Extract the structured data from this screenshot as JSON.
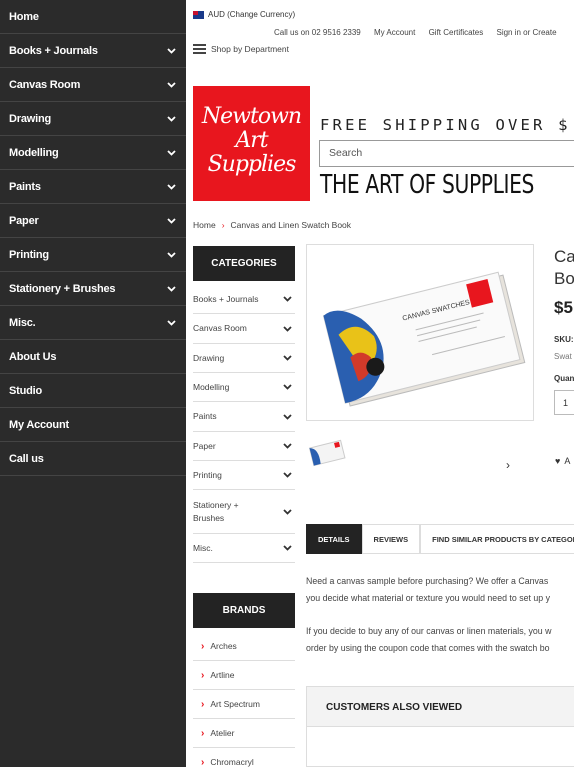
{
  "drawer": {
    "items": [
      {
        "label": "Home",
        "has_chevron": false
      },
      {
        "label": "Books + Journals",
        "has_chevron": true
      },
      {
        "label": "Canvas Room",
        "has_chevron": true
      },
      {
        "label": "Drawing",
        "has_chevron": true
      },
      {
        "label": "Modelling",
        "has_chevron": true
      },
      {
        "label": "Paints",
        "has_chevron": true
      },
      {
        "label": "Paper",
        "has_chevron": true
      },
      {
        "label": "Printing",
        "has_chevron": true
      },
      {
        "label": "Stationery + Brushes",
        "has_chevron": true
      },
      {
        "label": "Misc.",
        "has_chevron": true
      },
      {
        "label": "About Us",
        "has_chevron": false
      },
      {
        "label": "Studio",
        "has_chevron": false
      },
      {
        "label": "My Account",
        "has_chevron": false
      },
      {
        "label": "Call us",
        "has_chevron": false
      }
    ]
  },
  "header": {
    "currency": "AUD (Change Currency)",
    "phone": "Call us on 02 9516 2339",
    "my_account": "My Account",
    "gift_certificates": "Gift Certificates",
    "sign_in": "Sign in or Create",
    "shop_by_department": "Shop by Department",
    "logo": {
      "line1": "Newtown",
      "line2": "Art",
      "line3": "Supplies"
    },
    "free_shipping": "FREE SHIPPING OVER $",
    "search_placeholder": "Search",
    "tagline": "THE ART OF SUPPLIES"
  },
  "breadcrumb": {
    "home": "Home",
    "separator": "›",
    "current": "Canvas and Linen Swatch Book"
  },
  "categories": {
    "title": "CATEGORIES",
    "items": [
      {
        "label": "Books + Journals"
      },
      {
        "label": "Canvas Room"
      },
      {
        "label": "Drawing"
      },
      {
        "label": "Modelling"
      },
      {
        "label": "Paints"
      },
      {
        "label": "Paper"
      },
      {
        "label": "Printing"
      },
      {
        "label": "Stationery +\nBrushes"
      },
      {
        "label": "Misc."
      }
    ]
  },
  "brands": {
    "title": "BRANDS",
    "items": [
      {
        "label": "Arches"
      },
      {
        "label": "Artline"
      },
      {
        "label": "Art Spectrum"
      },
      {
        "label": "Atelier"
      },
      {
        "label": "Chromacryl"
      }
    ]
  },
  "product": {
    "title_line1": "Ca",
    "title_line2": "Bo",
    "price": "$5",
    "sku_label": "SKU:",
    "sku_value": "Swat",
    "quantity_label": "Quan",
    "quantity_value": "1",
    "wishlist_label": "A",
    "image_text": "CANVAS SWATCHES",
    "next_arrow": "›"
  },
  "tabs": [
    {
      "label": "DETAILS",
      "active": true
    },
    {
      "label": "REVIEWS",
      "active": false
    },
    {
      "label": "FIND SIMILAR PRODUCTS BY CATEGORY",
      "active": false
    }
  ],
  "description": {
    "p1_line1": "Need a canvas sample before purchasing? We offer a Canvas",
    "p1_line2": "you decide what material or texture you would need to set up y",
    "p2_line1": "If you decide to buy any of our canvas or linen materials, you w",
    "p2_line2": "order by using the coupon code that comes with the swatch bo"
  },
  "customers_also_viewed": {
    "title": "CUSTOMERS ALSO VIEWED"
  },
  "colors": {
    "brand_red": "#e8161e",
    "drawer_bg": "#2b2b2b",
    "dark_header": "#232323"
  }
}
